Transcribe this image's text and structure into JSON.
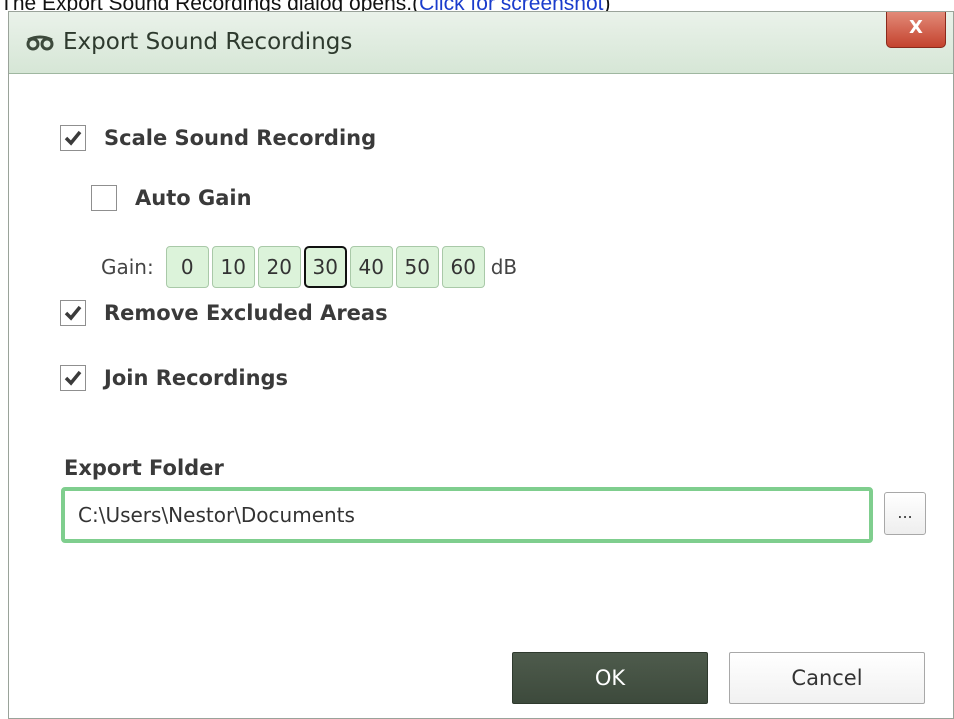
{
  "caption": {
    "text": "The Export Sound Recordings dialog opens.(",
    "link": "Click for screenshot",
    "suffix": ")"
  },
  "dialog": {
    "title": "Export Sound Recordings",
    "title_icon": "glasses-icon",
    "close_label": "X"
  },
  "options": {
    "scale_label": "Scale Sound Recording",
    "scale_checked": true,
    "auto_gain_label": "Auto Gain",
    "auto_gain_checked": false,
    "remove_excluded_label": "Remove Excluded Areas",
    "remove_excluded_checked": true,
    "join_label": "Join Recordings",
    "join_checked": true
  },
  "gain": {
    "label": "Gain:",
    "values": [
      "0",
      "10",
      "20",
      "30",
      "40",
      "50",
      "60"
    ],
    "selected": "30",
    "unit": "dB"
  },
  "export": {
    "label": "Export Folder",
    "path": "C:\\Users\\Nestor\\Documents",
    "browse_label": "..."
  },
  "buttons": {
    "ok": "OK",
    "cancel": "Cancel"
  },
  "colors": {
    "title_bar": "#d6e6d6",
    "close_button": "#c4432e",
    "gain_button": "#dcf3da",
    "focus_border": "#7fce8e",
    "ok_button": "#46533f"
  }
}
